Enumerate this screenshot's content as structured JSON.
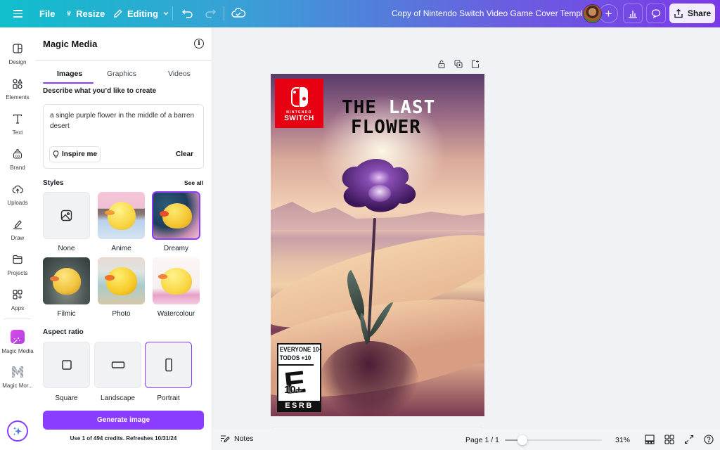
{
  "topbar": {
    "file": "File",
    "resize": "Resize",
    "editing": "Editing",
    "doc_title": "Copy of Nintendo Switch Video Game Cover Template",
    "share": "Share",
    "icons": [
      "menu-icon",
      "crown-icon",
      "pencil-icon",
      "chevron-down-icon",
      "undo-icon",
      "redo-icon",
      "cloud-check-icon",
      "avatar",
      "plus-icon",
      "analytics-icon",
      "comment-icon",
      "share-upload-icon"
    ]
  },
  "rail": {
    "items": [
      {
        "label": "Design",
        "icon": "layout-icon"
      },
      {
        "label": "Elements",
        "icon": "shapes-icon"
      },
      {
        "label": "Text",
        "icon": "text-icon"
      },
      {
        "label": "Brand",
        "icon": "brand-icon"
      },
      {
        "label": "Uploads",
        "icon": "cloud-upload-icon"
      },
      {
        "label": "Draw",
        "icon": "draw-icon"
      },
      {
        "label": "Projects",
        "icon": "folder-icon"
      },
      {
        "label": "Apps",
        "icon": "apps-icon"
      },
      {
        "label": "Magic Media",
        "icon": "magic-media-icon"
      },
      {
        "label": "Magic Mor...",
        "icon": "magic-morph-icon"
      }
    ],
    "assistant_icon": "sparkle-icon"
  },
  "panel": {
    "title": "Magic Media",
    "tabs": [
      {
        "label": "Images",
        "active": true
      },
      {
        "label": "Graphics",
        "active": false
      },
      {
        "label": "Videos",
        "active": false
      }
    ],
    "prompt_label": "Describe what you’d like to create",
    "prompt_value": "a single purple flower in the middle of a barren desert",
    "inspire_label": "Inspire me",
    "clear_label": "Clear",
    "styles_label": "Styles",
    "see_all": "See all",
    "styles": [
      {
        "label": "None",
        "selected": false
      },
      {
        "label": "Anime",
        "selected": false
      },
      {
        "label": "Dreamy",
        "selected": true
      },
      {
        "label": "Filmic",
        "selected": false
      },
      {
        "label": "Photo",
        "selected": false
      },
      {
        "label": "Watercolour",
        "selected": false
      }
    ],
    "aspect_label": "Aspect ratio",
    "aspects": [
      {
        "label": "Square",
        "selected": false
      },
      {
        "label": "Landscape",
        "selected": false
      },
      {
        "label": "Portrait",
        "selected": true
      }
    ],
    "generate_label": "Generate image",
    "credits_text": "Use 1 of 494 credits. Refreshes 10/31/24"
  },
  "canvas": {
    "cover": {
      "logo_text_top": "NINTENDO",
      "logo_text_bottom": "SWITCH",
      "title_word1": "THE",
      "title_word2": "LAST",
      "title_line2": "FLOWER",
      "rating_line1": "EVERYONE 10+",
      "rating_line2": "TODOS +10",
      "rating_letter": "E",
      "rating_age": "10+",
      "rating_org": "ESRB"
    }
  },
  "bottombar": {
    "notes": "Notes",
    "page_indicator": "Page 1 / 1",
    "zoom_percent": "31%",
    "zoom_value": 31
  },
  "colors": {
    "accent": "#8b3dff",
    "nintendo_red": "#e60012"
  }
}
